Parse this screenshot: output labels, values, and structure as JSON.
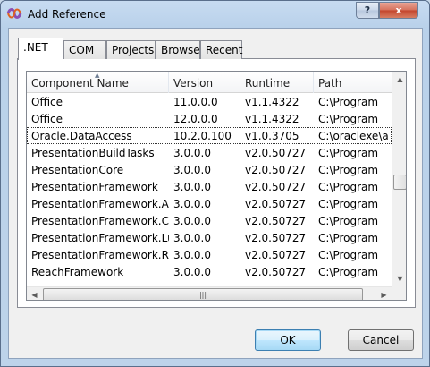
{
  "window": {
    "title": "Add Reference",
    "help_glyph": "?",
    "close_glyph": "x"
  },
  "tabs": [
    {
      "label": ".NET",
      "active": true
    },
    {
      "label": "COM",
      "active": false
    },
    {
      "label": "Projects",
      "active": false
    },
    {
      "label": "Browse",
      "active": false
    },
    {
      "label": "Recent",
      "active": false
    }
  ],
  "list": {
    "columns": [
      "Component Name",
      "Version",
      "Runtime",
      "Path"
    ],
    "sort_column": "Component Name",
    "rows": [
      {
        "name": "Office",
        "version": "11.0.0.0",
        "runtime": "v1.1.4322",
        "path": "C:\\Program",
        "selected": false
      },
      {
        "name": "Office",
        "version": "12.0.0.0",
        "runtime": "v1.1.4322",
        "path": "C:\\Program",
        "selected": false
      },
      {
        "name": "Oracle.DataAccess",
        "version": "10.2.0.100",
        "runtime": "v1.0.3705",
        "path": "C:\\oraclexe\\a",
        "selected": true
      },
      {
        "name": "PresentationBuildTasks",
        "version": "3.0.0.0",
        "runtime": "v2.0.50727",
        "path": "C:\\Program",
        "selected": false
      },
      {
        "name": "PresentationCore",
        "version": "3.0.0.0",
        "runtime": "v2.0.50727",
        "path": "C:\\Program",
        "selected": false
      },
      {
        "name": "PresentationFramework",
        "version": "3.0.0.0",
        "runtime": "v2.0.50727",
        "path": "C:\\Program",
        "selected": false
      },
      {
        "name": "PresentationFramework.A...",
        "version": "3.0.0.0",
        "runtime": "v2.0.50727",
        "path": "C:\\Program",
        "selected": false
      },
      {
        "name": "PresentationFramework.Cl...",
        "version": "3.0.0.0",
        "runtime": "v2.0.50727",
        "path": "C:\\Program",
        "selected": false
      },
      {
        "name": "PresentationFramework.Lu...",
        "version": "3.0.0.0",
        "runtime": "v2.0.50727",
        "path": "C:\\Program",
        "selected": false
      },
      {
        "name": "PresentationFramework.R...",
        "version": "3.0.0.0",
        "runtime": "v2.0.50727",
        "path": "C:\\Program",
        "selected": false
      },
      {
        "name": "ReachFramework",
        "version": "3.0.0.0",
        "runtime": "v2.0.50727",
        "path": "C:\\Program",
        "selected": false
      }
    ]
  },
  "scrollbars": {
    "up_glyph": "▲",
    "down_glyph": "▼",
    "left_glyph": "◀",
    "right_glyph": "▶",
    "grip_glyph": "|||"
  },
  "buttons": {
    "ok": "OK",
    "cancel": "Cancel"
  },
  "colors": {
    "titlebar": "#c7dbf1",
    "close_button": "#c3452d",
    "default_button_border": "#3c7fb1"
  }
}
